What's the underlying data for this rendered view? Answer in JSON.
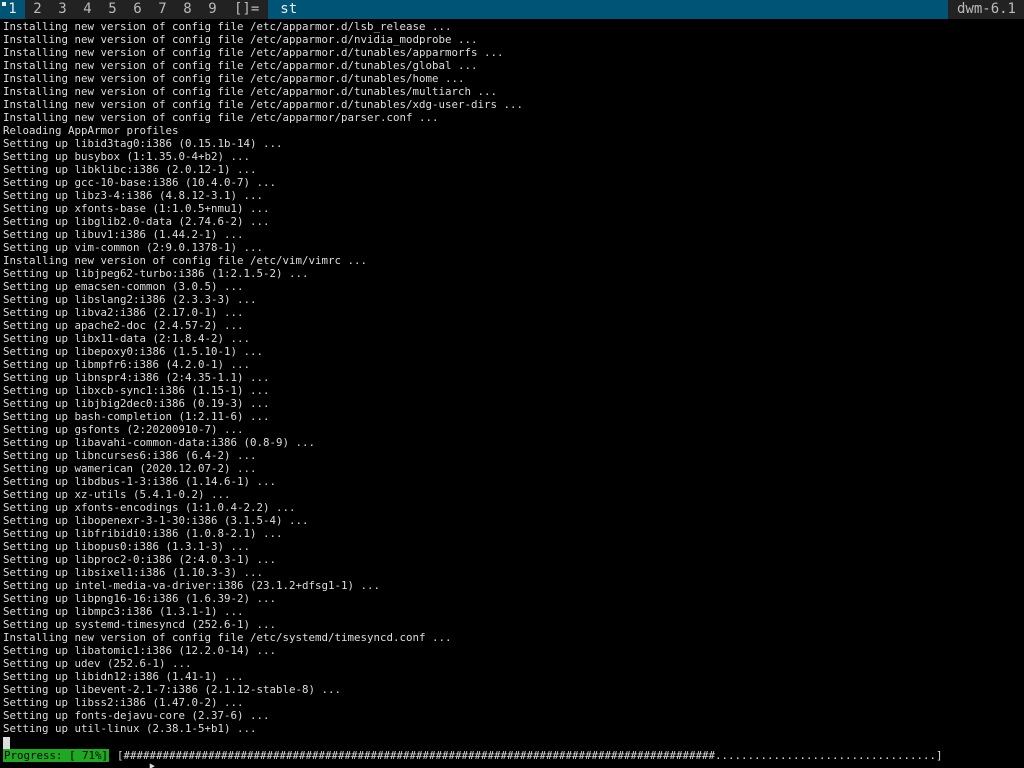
{
  "bar": {
    "tags": [
      "1",
      "2",
      "3",
      "4",
      "5",
      "6",
      "7",
      "8",
      "9"
    ],
    "selected_tag": "1",
    "layout_symbol": "[]=",
    "window_title": "st",
    "status": "dwm-6.1"
  },
  "terminal": {
    "lines": [
      "Installing new version of config file /etc/apparmor.d/lsb_release ...",
      "Installing new version of config file /etc/apparmor.d/nvidia_modprobe ...",
      "Installing new version of config file /etc/apparmor.d/tunables/apparmorfs ...",
      "Installing new version of config file /etc/apparmor.d/tunables/global ...",
      "Installing new version of config file /etc/apparmor.d/tunables/home ...",
      "Installing new version of config file /etc/apparmor.d/tunables/multiarch ...",
      "Installing new version of config file /etc/apparmor.d/tunables/xdg-user-dirs ...",
      "Installing new version of config file /etc/apparmor/parser.conf ...",
      "Reloading AppArmor profiles",
      "Setting up libid3tag0:i386 (0.15.1b-14) ...",
      "Setting up busybox (1:1.35.0-4+b2) ...",
      "Setting up libklibc:i386 (2.0.12-1) ...",
      "Setting up gcc-10-base:i386 (10.4.0-7) ...",
      "Setting up libz3-4:i386 (4.8.12-3.1) ...",
      "Setting up xfonts-base (1:1.0.5+nmu1) ...",
      "Setting up libglib2.0-data (2.74.6-2) ...",
      "Setting up libuv1:i386 (1.44.2-1) ...",
      "Setting up vim-common (2:9.0.1378-1) ...",
      "Installing new version of config file /etc/vim/vimrc ...",
      "Setting up libjpeg62-turbo:i386 (1:2.1.5-2) ...",
      "Setting up emacsen-common (3.0.5) ...",
      "Setting up libslang2:i386 (2.3.3-3) ...",
      "Setting up libva2:i386 (2.17.0-1) ...",
      "Setting up apache2-doc (2.4.57-2) ...",
      "Setting up libx11-data (2:1.8.4-2) ...",
      "Setting up libepoxy0:i386 (1.5.10-1) ...",
      "Setting up libmpfr6:i386 (4.2.0-1) ...",
      "Setting up libnspr4:i386 (2:4.35-1.1) ...",
      "Setting up libxcb-sync1:i386 (1.15-1) ...",
      "Setting up libjbig2dec0:i386 (0.19-3) ...",
      "Setting up bash-completion (1:2.11-6) ...",
      "Setting up gsfonts (2:20200910-7) ...",
      "Setting up libavahi-common-data:i386 (0.8-9) ...",
      "Setting up libncurses6:i386 (6.4-2) ...",
      "Setting up wamerican (2020.12.07-2) ...",
      "Setting up libdbus-1-3:i386 (1.14.6-1) ...",
      "Setting up xz-utils (5.4.1-0.2) ...",
      "Setting up xfonts-encodings (1:1.0.4-2.2) ...",
      "Setting up libopenexr-3-1-30:i386 (3.1.5-4) ...",
      "Setting up libfribidi0:i386 (1.0.8-2.1) ...",
      "Setting up libopus0:i386 (1.3.1-3) ...",
      "Setting up libproc2-0:i386 (2:4.0.3-1) ...",
      "Setting up libsixel1:i386 (1.10.3-3) ...",
      "Setting up intel-media-va-driver:i386 (23.1.2+dfsg1-1) ...",
      "Setting up libpng16-16:i386 (1.6.39-2) ...",
      "Setting up libmpc3:i386 (1.3.1-1) ...",
      "Setting up systemd-timesyncd (252.6-1) ...",
      "Installing new version of config file /etc/systemd/timesyncd.conf ...",
      "Setting up libatomic1:i386 (12.2.0-14) ...",
      "Setting up udev (252.6-1) ...",
      "Setting up libidn12:i386 (1.41-1) ...",
      "Setting up libevent-2.1-7:i386 (2.1.12-stable-8) ...",
      "Setting up libss2:i386 (1.47.0-2) ...",
      "Setting up fonts-dejavu-core (2.37-6) ...",
      "Setting up util-linux (2.38.1-5+b1) ..."
    ],
    "progress_label": "Progress: [ 71%]",
    "progress_bar": "[###########################################################################################..................................]",
    "progress_percent": 71
  },
  "colors": {
    "bar_bg": "#222222",
    "bar_fg": "#bbbbbb",
    "accent": "#005577",
    "accent_fg": "#eeeeee",
    "term_bg": "#000000",
    "term_fg": "#dddddd",
    "progress_bg": "#1fa821"
  }
}
